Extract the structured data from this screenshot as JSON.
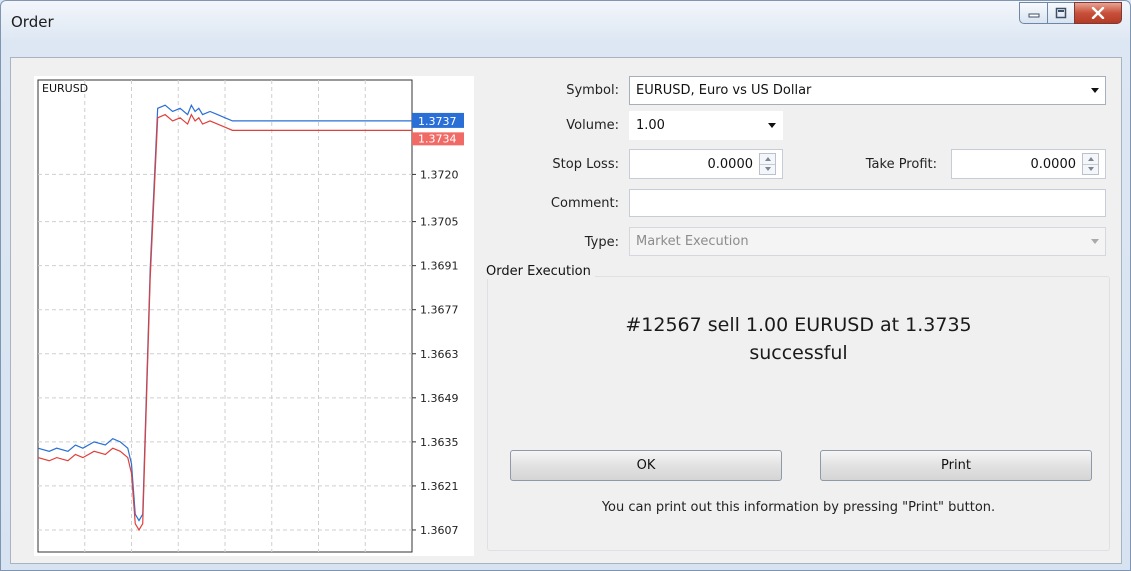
{
  "window": {
    "title": "Order",
    "buttons": [
      "minimize-icon",
      "maximize-icon",
      "close-icon"
    ]
  },
  "chart_data": {
    "type": "line",
    "symbol": "EURUSD",
    "y_ticks": [
      "1.3720",
      "1.3705",
      "1.3691",
      "1.3677",
      "1.3663",
      "1.3649",
      "1.3635",
      "1.3621",
      "1.3607"
    ],
    "ylim": [
      1.36,
      1.375
    ],
    "ask_label": "1.3737",
    "bid_label": "1.3734",
    "grid": true,
    "series": [
      {
        "color": "#2a6fd6",
        "x": [
          0,
          3,
          5,
          8,
          10,
          12,
          15,
          18,
          20,
          22,
          24,
          25,
          26,
          27,
          28,
          30,
          32,
          34,
          36,
          38,
          40,
          41,
          42,
          43,
          44,
          46,
          48,
          50,
          52,
          56,
          60,
          64,
          70,
          75,
          80,
          85,
          90,
          95,
          100
        ],
        "y": [
          1.3633,
          1.3632,
          1.3633,
          1.3632,
          1.3634,
          1.3633,
          1.3635,
          1.3634,
          1.3636,
          1.3635,
          1.3633,
          1.3628,
          1.3612,
          1.361,
          1.3612,
          1.369,
          1.3741,
          1.3742,
          1.374,
          1.3741,
          1.3739,
          1.3742,
          1.374,
          1.3741,
          1.3739,
          1.374,
          1.3739,
          1.3738,
          1.3737,
          1.3737,
          1.3737,
          1.3737,
          1.3737,
          1.3737,
          1.3737,
          1.3737,
          1.3737,
          1.3737,
          1.3737
        ]
      },
      {
        "color": "#e0403a",
        "x": [
          0,
          3,
          5,
          8,
          10,
          12,
          15,
          18,
          20,
          22,
          24,
          25,
          26,
          27,
          28,
          30,
          32,
          34,
          36,
          38,
          40,
          41,
          42,
          43,
          44,
          46,
          48,
          50,
          52,
          56,
          60,
          64,
          70,
          75,
          80,
          85,
          90,
          95,
          100
        ],
        "y": [
          1.363,
          1.3629,
          1.363,
          1.3629,
          1.3631,
          1.363,
          1.3632,
          1.3631,
          1.3633,
          1.3632,
          1.363,
          1.3625,
          1.3609,
          1.3607,
          1.3609,
          1.3687,
          1.3738,
          1.3739,
          1.3737,
          1.3738,
          1.3736,
          1.3739,
          1.3737,
          1.3738,
          1.3736,
          1.3737,
          1.3736,
          1.3735,
          1.3734,
          1.3734,
          1.3734,
          1.3734,
          1.3734,
          1.3734,
          1.3734,
          1.3734,
          1.3734,
          1.3734,
          1.3734
        ]
      }
    ]
  },
  "form": {
    "symbol_label": "Symbol:",
    "symbol_value": "EURUSD, Euro vs US Dollar",
    "volume_label": "Volume:",
    "volume_value": "1.00",
    "sl_label": "Stop Loss:",
    "sl_value": "0.0000",
    "tp_label": "Take Profit:",
    "tp_value": "0.0000",
    "comment_label": "Comment:",
    "comment_value": "",
    "type_label": "Type:",
    "type_value": "Market Execution"
  },
  "execution": {
    "group_title": "Order Execution",
    "result_line1": "#12567 sell 1.00 EURUSD at 1.3735",
    "result_line2": "successful",
    "ok_label": "OK",
    "print_label": "Print",
    "hint": "You can print out this information by pressing \"Print\" button."
  }
}
